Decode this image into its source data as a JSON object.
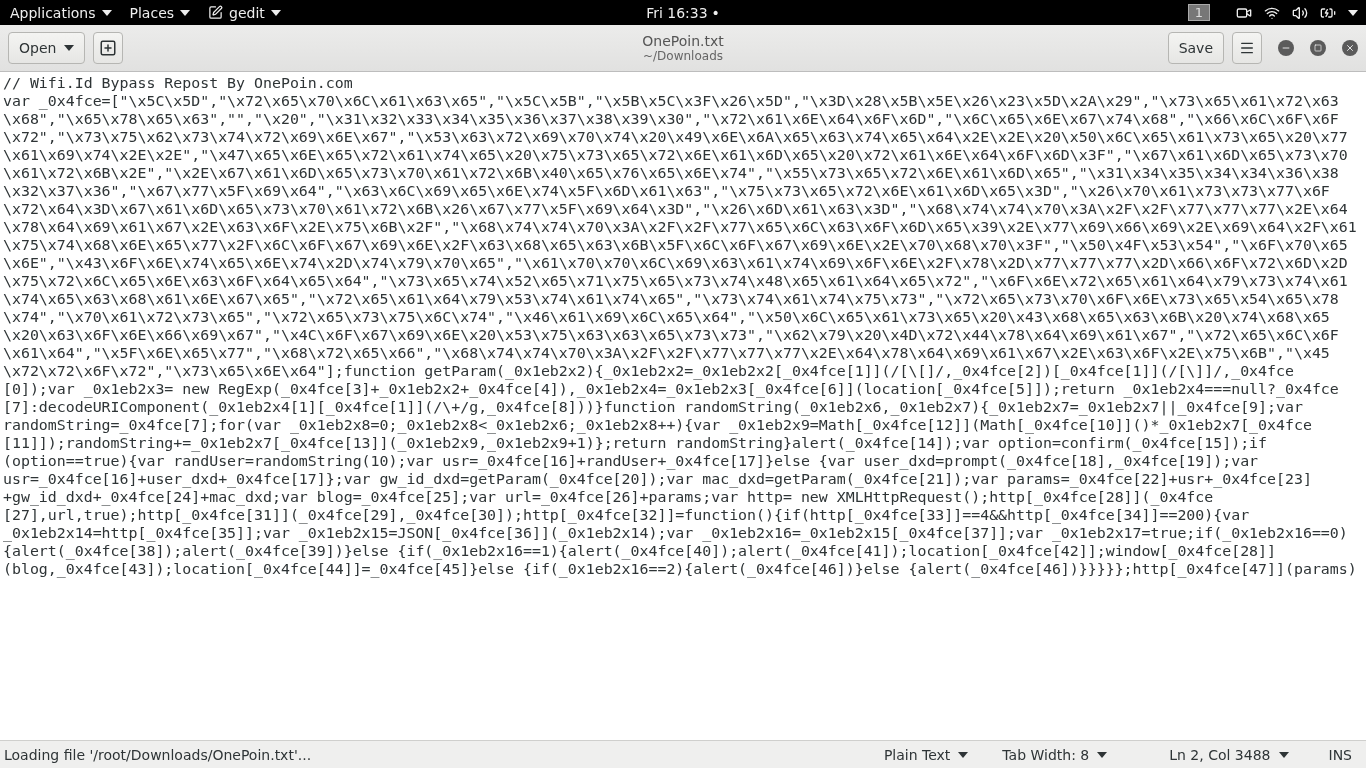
{
  "top_bar": {
    "menus": [
      {
        "label": "Applications",
        "kind": "plain"
      },
      {
        "label": "Places",
        "kind": "plain"
      },
      {
        "label": "gedit",
        "kind": "app"
      }
    ],
    "clock": "Fri 16:33",
    "notification": "•",
    "workspace": "1"
  },
  "header_bar": {
    "open_button": "Open",
    "title": "OnePoin.txt",
    "subtitle": "~/Downloads",
    "save_button": "Save"
  },
  "editor": {
    "rows": [
      "// Wifi.Id Bypass Repost By OnePoin.com",
      "var _0x4fce=[\"\\x5C\\x5D\",\"\\x72\\x65\\x70\\x6C\\x61\\x63\\x65\",\"\\x5C\\x5B\",\"\\x5B\\x5C\\x3F\\x26\\x5D\",\"\\x3D\\x28\\x5B\\x5E\\x26\\x23\\x5D\\x2A\\x29\",\"\\x73\\x65\\x61\\x72\\x63",
      "\\x68\",\"\\x65\\x78\\x65\\x63\",\"\",\"\\x20\",\"\\x31\\x32\\x33\\x34\\x35\\x36\\x37\\x38\\x39\\x30\",\"\\x72\\x61\\x6E\\x64\\x6F\\x6D\",\"\\x6C\\x65\\x6E\\x67\\x74\\x68\",\"\\x66\\x6C\\x6F\\x6F",
      "\\x72\",\"\\x73\\x75\\x62\\x73\\x74\\x72\\x69\\x6E\\x67\",\"\\x53\\x63\\x72\\x69\\x70\\x74\\x20\\x49\\x6E\\x6A\\x65\\x63\\x74\\x65\\x64\\x2E\\x2E\\x20\\x50\\x6C\\x65\\x61\\x73\\x65\\x20\\x77",
      "\\x61\\x69\\x74\\x2E\\x2E\",\"\\x47\\x65\\x6E\\x65\\x72\\x61\\x74\\x65\\x20\\x75\\x73\\x65\\x72\\x6E\\x61\\x6D\\x65\\x20\\x72\\x61\\x6E\\x64\\x6F\\x6D\\x3F\",\"\\x67\\x61\\x6D\\x65\\x73\\x70",
      "\\x61\\x72\\x6B\\x2E\",\"\\x2E\\x67\\x61\\x6D\\x65\\x73\\x70\\x61\\x72\\x6B\\x40\\x65\\x76\\x65\\x6E\\x74\",\"\\x55\\x73\\x65\\x72\\x6E\\x61\\x6D\\x65\",\"\\x31\\x34\\x35\\x34\\x34\\x36\\x38",
      "\\x32\\x37\\x36\",\"\\x67\\x77\\x5F\\x69\\x64\",\"\\x63\\x6C\\x69\\x65\\x6E\\x74\\x5F\\x6D\\x61\\x63\",\"\\x75\\x73\\x65\\x72\\x6E\\x61\\x6D\\x65\\x3D\",\"\\x26\\x70\\x61\\x73\\x73\\x77\\x6F",
      "\\x72\\x64\\x3D\\x67\\x61\\x6D\\x65\\x73\\x70\\x61\\x72\\x6B\\x26\\x67\\x77\\x5F\\x69\\x64\\x3D\",\"\\x26\\x6D\\x61\\x63\\x3D\",\"\\x68\\x74\\x74\\x70\\x3A\\x2F\\x2F\\x77\\x77\\x77\\x2E\\x64",
      "\\x78\\x64\\x69\\x61\\x67\\x2E\\x63\\x6F\\x2E\\x75\\x6B\\x2F\",\"\\x68\\x74\\x74\\x70\\x3A\\x2F\\x2F\\x77\\x65\\x6C\\x63\\x6F\\x6D\\x65\\x39\\x2E\\x77\\x69\\x66\\x69\\x2E\\x69\\x64\\x2F\\x61",
      "\\x75\\x74\\x68\\x6E\\x65\\x77\\x2F\\x6C\\x6F\\x67\\x69\\x6E\\x2F\\x63\\x68\\x65\\x63\\x6B\\x5F\\x6C\\x6F\\x67\\x69\\x6E\\x2E\\x70\\x68\\x70\\x3F\",\"\\x50\\x4F\\x53\\x54\",\"\\x6F\\x70\\x65",
      "\\x6E\",\"\\x43\\x6F\\x6E\\x74\\x65\\x6E\\x74\\x2D\\x74\\x79\\x70\\x65\",\"\\x61\\x70\\x70\\x6C\\x69\\x63\\x61\\x74\\x69\\x6F\\x6E\\x2F\\x78\\x2D\\x77\\x77\\x77\\x2D\\x66\\x6F\\x72\\x6D\\x2D",
      "\\x75\\x72\\x6C\\x65\\x6E\\x63\\x6F\\x64\\x65\\x64\",\"\\x73\\x65\\x74\\x52\\x65\\x71\\x75\\x65\\x73\\x74\\x48\\x65\\x61\\x64\\x65\\x72\",\"\\x6F\\x6E\\x72\\x65\\x61\\x64\\x79\\x73\\x74\\x61",
      "\\x74\\x65\\x63\\x68\\x61\\x6E\\x67\\x65\",\"\\x72\\x65\\x61\\x64\\x79\\x53\\x74\\x61\\x74\\x65\",\"\\x73\\x74\\x61\\x74\\x75\\x73\",\"\\x72\\x65\\x73\\x70\\x6F\\x6E\\x73\\x65\\x54\\x65\\x78",
      "\\x74\",\"\\x70\\x61\\x72\\x73\\x65\",\"\\x72\\x65\\x73\\x75\\x6C\\x74\",\"\\x46\\x61\\x69\\x6C\\x65\\x64\",\"\\x50\\x6C\\x65\\x61\\x73\\x65\\x20\\x43\\x68\\x65\\x63\\x6B\\x20\\x74\\x68\\x65",
      "\\x20\\x63\\x6F\\x6E\\x66\\x69\\x67\",\"\\x4C\\x6F\\x67\\x69\\x6E\\x20\\x53\\x75\\x63\\x63\\x65\\x73\\x73\",\"\\x62\\x79\\x20\\x4D\\x72\\x44\\x78\\x64\\x69\\x61\\x67\",\"\\x72\\x65\\x6C\\x6F",
      "\\x61\\x64\",\"\\x5F\\x6E\\x65\\x77\",\"\\x68\\x72\\x65\\x66\",\"\\x68\\x74\\x74\\x70\\x3A\\x2F\\x2F\\x77\\x77\\x77\\x2E\\x64\\x78\\x64\\x69\\x61\\x67\\x2E\\x63\\x6F\\x2E\\x75\\x6B\",\"\\x45",
      "\\x72\\x72\\x6F\\x72\",\"\\x73\\x65\\x6E\\x64\"];function getParam(_0x1eb2x2){_0x1eb2x2=_0x1eb2x2[_0x4fce[1]](/[\\[]/,_0x4fce[2])[_0x4fce[1]](/[\\]]/,_0x4fce",
      "[0]);var _0x1eb2x3= new RegExp(_0x4fce[3]+_0x1eb2x2+_0x4fce[4]),_0x1eb2x4=_0x1eb2x3[_0x4fce[6]](location[_0x4fce[5]]);return _0x1eb2x4===null?_0x4fce",
      "[7]:decodeURIComponent(_0x1eb2x4[1][_0x4fce[1]](/\\+/g,_0x4fce[8]))}function randomString(_0x1eb2x6,_0x1eb2x7){_0x1eb2x7=_0x1eb2x7||_0x4fce[9];var",
      "randomString=_0x4fce[7];for(var _0x1eb2x8=0;_0x1eb2x8<_0x1eb2x6;_0x1eb2x8++){var _0x1eb2x9=Math[_0x4fce[12]](Math[_0x4fce[10]]()*_0x1eb2x7[_0x4fce",
      "[11]]);randomString+=_0x1eb2x7[_0x4fce[13]](_0x1eb2x9,_0x1eb2x9+1)};return randomString}alert(_0x4fce[14]);var option=confirm(_0x4fce[15]);if",
      "(option==true){var randUser=randomString(10);var usr=_0x4fce[16]+randUser+_0x4fce[17]}else {var user_dxd=prompt(_0x4fce[18],_0x4fce[19]);var",
      "usr=_0x4fce[16]+user_dxd+_0x4fce[17]};var gw_id_dxd=getParam(_0x4fce[20]);var mac_dxd=getParam(_0x4fce[21]);var params=_0x4fce[22]+usr+_0x4fce[23]",
      "+gw_id_dxd+_0x4fce[24]+mac_dxd;var blog=_0x4fce[25];var url=_0x4fce[26]+params;var http= new XMLHttpRequest();http[_0x4fce[28]](_0x4fce",
      "[27],url,true);http[_0x4fce[31]](_0x4fce[29],_0x4fce[30]);http[_0x4fce[32]]=function(){if(http[_0x4fce[33]]==4&&http[_0x4fce[34]]==200){var",
      "_0x1eb2x14=http[_0x4fce[35]];var _0x1eb2x15=JSON[_0x4fce[36]](_0x1eb2x14);var _0x1eb2x16=_0x1eb2x15[_0x4fce[37]];var _0x1eb2x17=true;if(_0x1eb2x16==0)",
      "{alert(_0x4fce[38]);alert(_0x4fce[39])}else {if(_0x1eb2x16==1){alert(_0x4fce[40]);alert(_0x4fce[41]);location[_0x4fce[42]];window[_0x4fce[28]]",
      "(blog,_0x4fce[43]);location[_0x4fce[44]]=_0x4fce[45]}else {if(_0x1eb2x16==2){alert(_0x4fce[46])}else {alert(_0x4fce[46])}}}}};http[_0x4fce[47]](params)"
    ]
  },
  "status_bar": {
    "message": "Loading file '/root/Downloads/OnePoin.txt'...",
    "items": [
      {
        "label": "Plain Text"
      },
      {
        "label": "Tab Width: 8"
      },
      {
        "label": "Ln 2, Col 3488"
      }
    ],
    "mode": "INS"
  }
}
